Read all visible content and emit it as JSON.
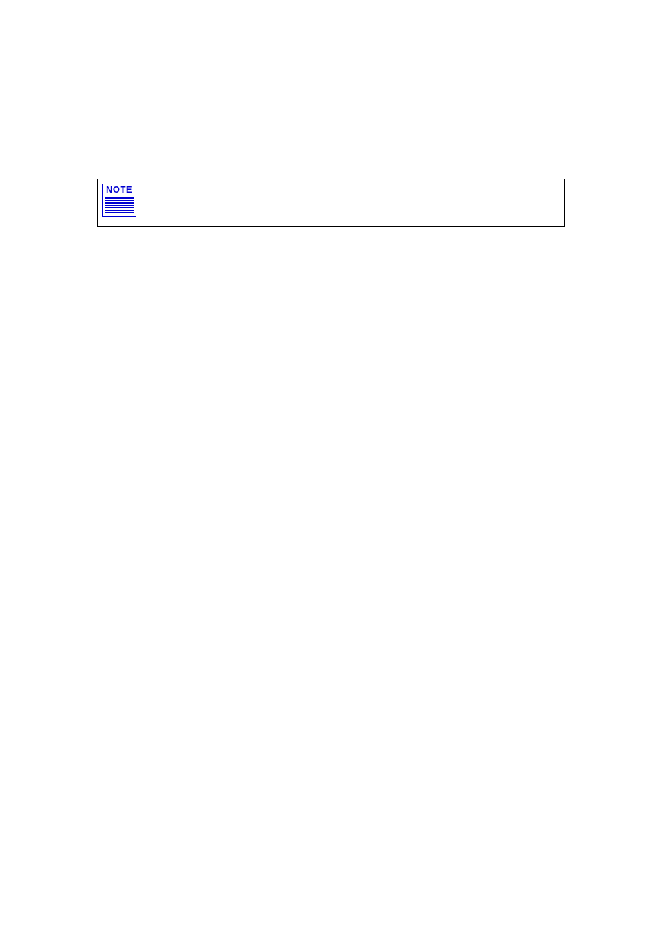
{
  "note": {
    "label": "NOTE",
    "icon_color": "#0000d0"
  }
}
